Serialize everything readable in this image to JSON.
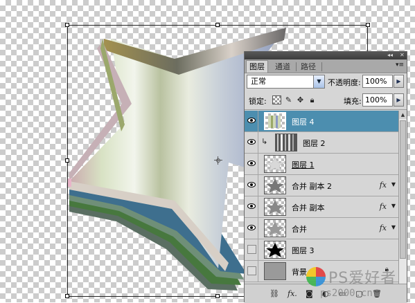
{
  "panel": {
    "tabs": [
      "图层",
      "通道",
      "路径"
    ],
    "active_tab": "图层",
    "blend_mode": "正常",
    "opacity_label": "不透明度:",
    "opacity_value": "100%",
    "lock_label": "锁定:",
    "fill_label": "填充:",
    "fill_value": "100%",
    "layers": [
      {
        "name": "图层 4",
        "visible": true,
        "selected": true,
        "fx": false
      },
      {
        "name": "图层 2",
        "visible": true,
        "selected": false,
        "fx": false,
        "clipped": true
      },
      {
        "name": "图层 1",
        "visible": true,
        "selected": false,
        "fx": false,
        "underlined": true
      },
      {
        "name": "合并 副本 2",
        "visible": true,
        "selected": false,
        "fx": true
      },
      {
        "name": "合并 副本",
        "visible": true,
        "selected": false,
        "fx": true
      },
      {
        "name": "合并",
        "visible": true,
        "selected": false,
        "fx": true
      },
      {
        "name": "图层 3",
        "visible": false,
        "selected": false,
        "fx": false
      },
      {
        "name": "背景",
        "visible": false,
        "selected": false,
        "fx": false,
        "locked": true
      }
    ],
    "fx_glyph": "fx"
  },
  "watermark": {
    "brand": "PS爱好者",
    "url": "ps2000.cn"
  },
  "colors": {
    "selection": "#4c8eaf",
    "panel_bg": "#d6d6d6"
  }
}
